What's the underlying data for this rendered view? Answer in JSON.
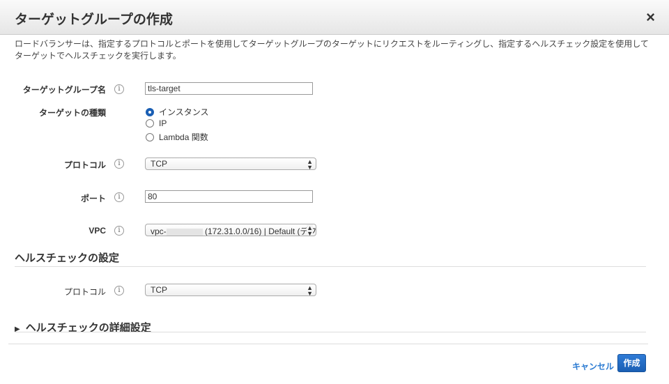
{
  "dialog": {
    "title": "ターゲットグループの作成",
    "close": "×",
    "description": "ロードバランサーは、指定するプロトコルとポートを使用してターゲットグループのターゲットにリクエストをルーティングし、指定するヘルスチェック設定を使用してターゲットでヘルスチェックを実行します。"
  },
  "form": {
    "name_label": "ターゲットグループ名",
    "name_value": "tls-target",
    "type_label": "ターゲットの種類",
    "type_options": [
      "インスタンス",
      "IP",
      "Lambda 関数"
    ],
    "type_selected": "インスタンス",
    "protocol_label": "プロトコル",
    "protocol_value": "TCP",
    "port_label": "ポート",
    "port_value": "80",
    "vpc_label": "VPC",
    "vpc_prefix": "vpc-",
    "vpc_suffix": "(172.31.0.0/16) | Default (デフ"
  },
  "health": {
    "title": "ヘルスチェックの設定",
    "protocol_label": "プロトコル",
    "protocol_value": "TCP",
    "advanced": "ヘルスチェックの詳細設定"
  },
  "footer": {
    "cancel": "キャンセル",
    "create": "作成"
  },
  "info_icon": "i"
}
